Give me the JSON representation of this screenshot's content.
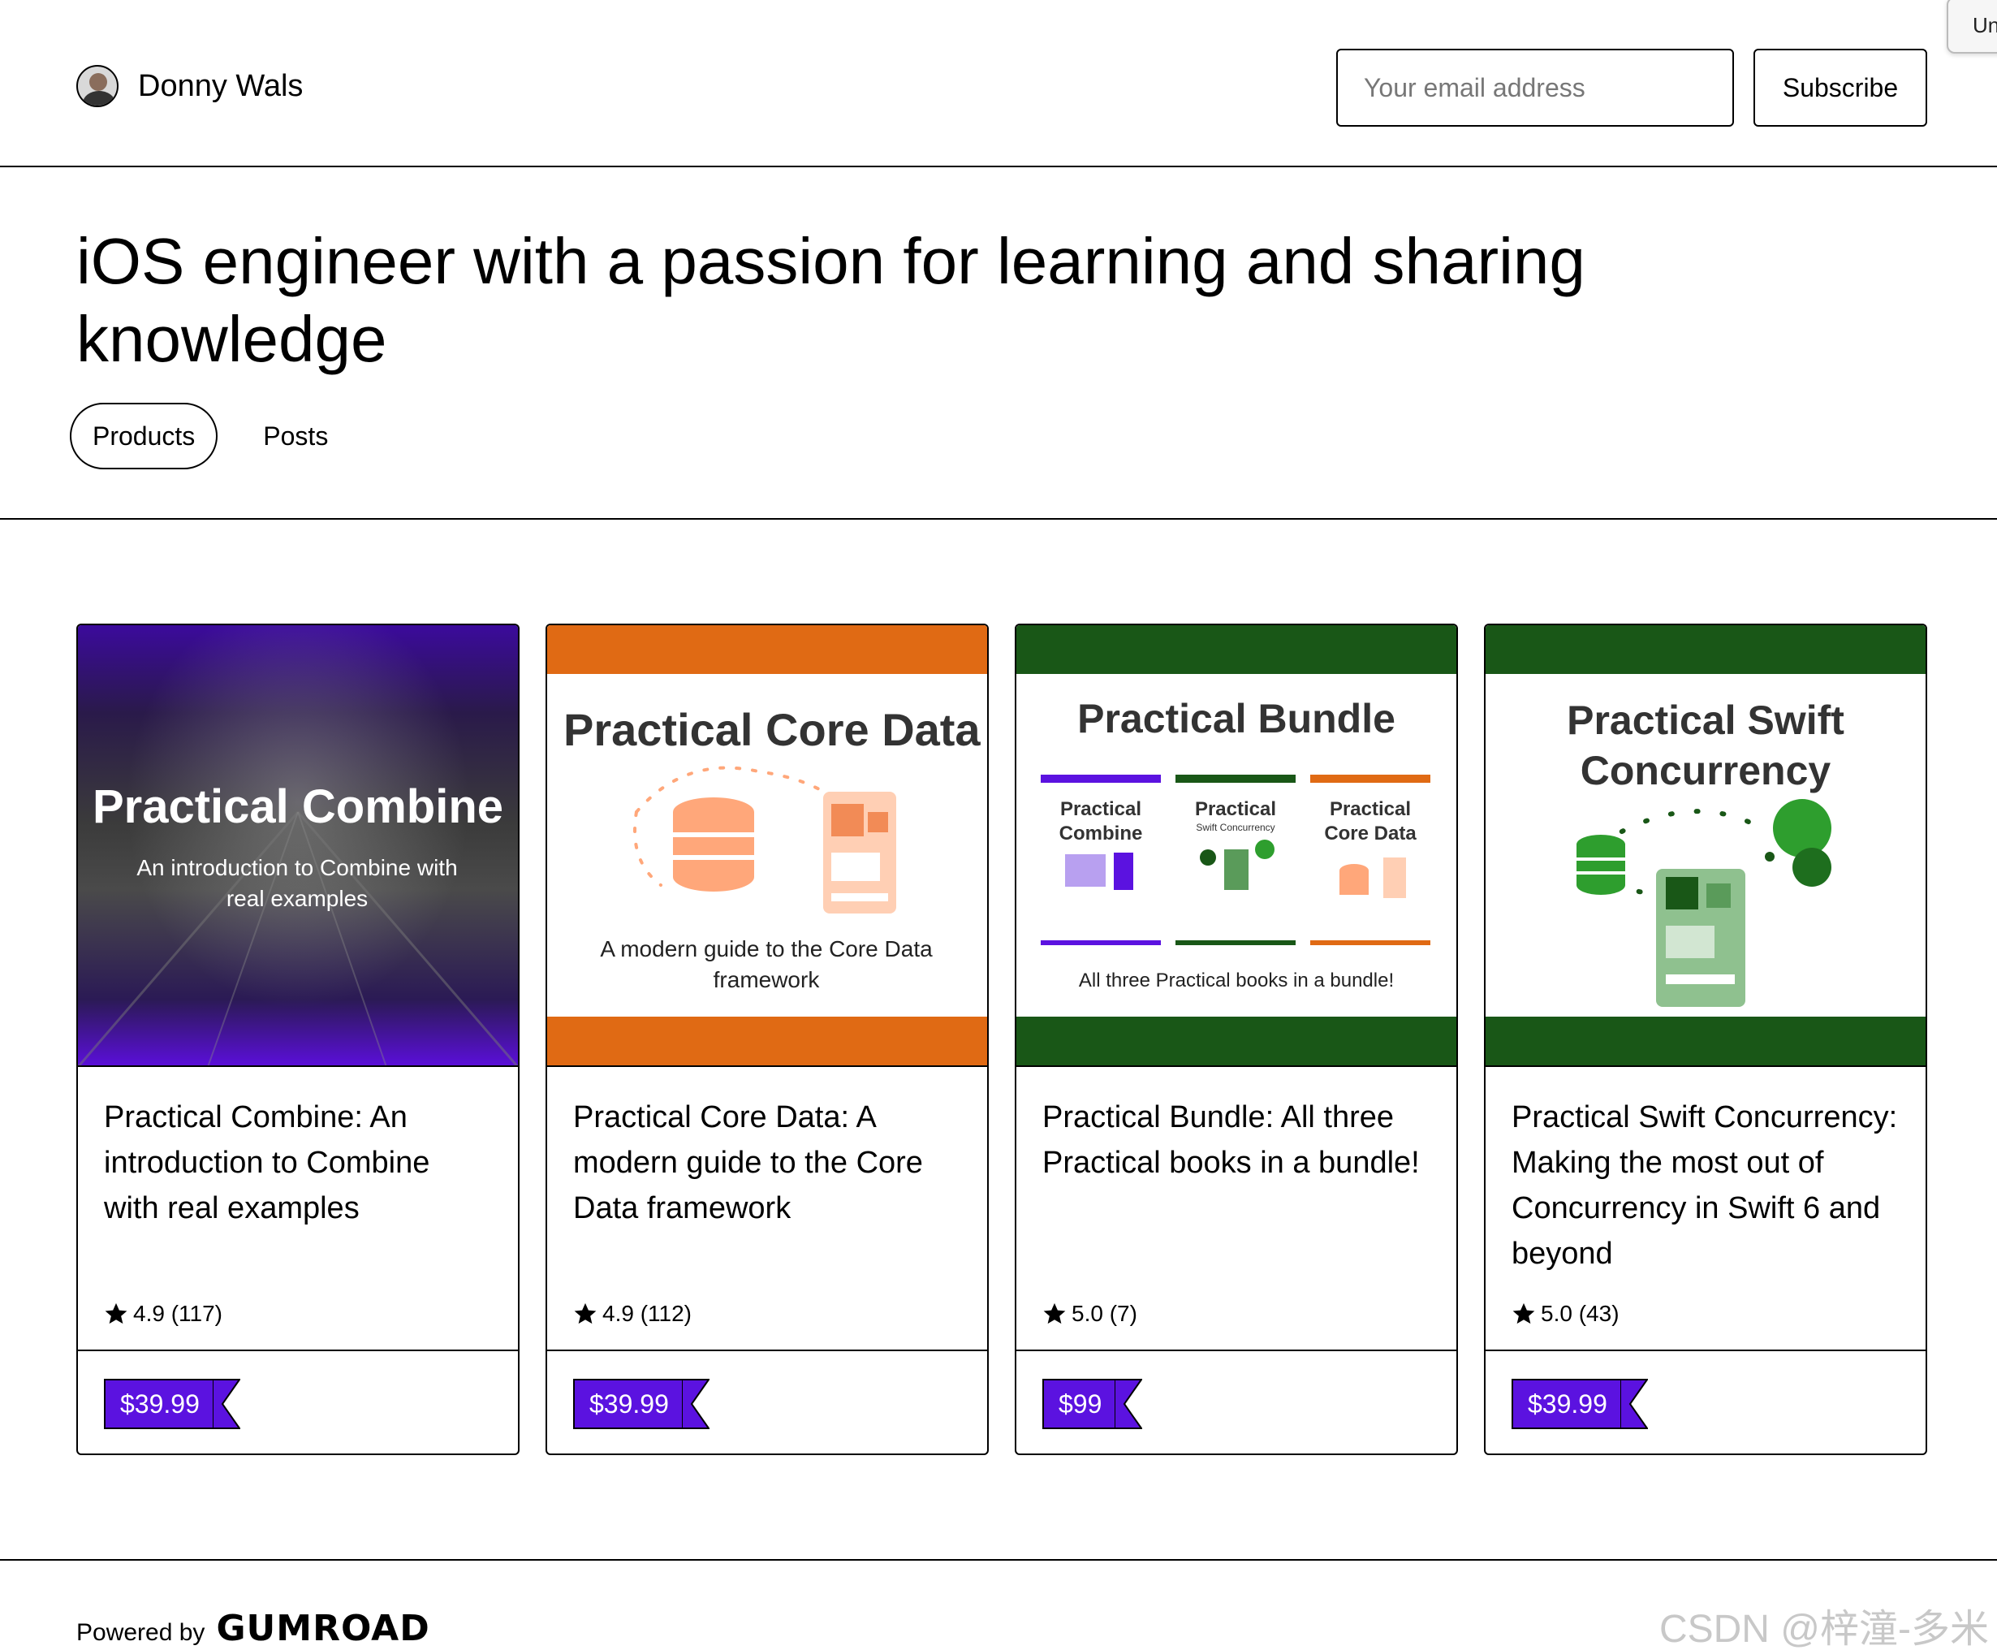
{
  "header": {
    "creator_name": "Donny Wals",
    "email_placeholder": "Your email address",
    "subscribe_label": "Subscribe",
    "corner_tab_label": "Un"
  },
  "hero": {
    "title": "iOS engineer with a passion for learning and sharing knowledge",
    "tabs": [
      {
        "label": "Products",
        "active": true
      },
      {
        "label": "Posts",
        "active": false
      }
    ]
  },
  "products": [
    {
      "title": "Practical Combine: An introduction to Combine with real examples",
      "rating": "4.9",
      "rating_count": "(117)",
      "price": "$39.99",
      "cover": {
        "heading": "Practical Combine",
        "subheading": "An introduction to Combine with real examples",
        "accent": "#5b12e0"
      }
    },
    {
      "title": "Practical Core Data: A modern guide to the Core Data framework",
      "rating": "4.9",
      "rating_count": "(112)",
      "price": "$39.99",
      "cover": {
        "heading": "Practical Core Data",
        "subheading": "A modern guide to the Core Data framework",
        "accent": "#e06a14"
      }
    },
    {
      "title": "Practical Bundle: All three Practical books in a bundle!",
      "rating": "5.0",
      "rating_count": "(7)",
      "price": "$99",
      "cover": {
        "heading": "Practical Bundle",
        "subheading": "All three Practical books in a bundle!",
        "accent": "#195717",
        "books": [
          {
            "title": "Practical Combine",
            "subtitle": "",
            "color": "#5b12e0"
          },
          {
            "title": "Practical",
            "subtitle": "Swift Concurrency",
            "color": "#195717"
          },
          {
            "title": "Practical Core Data",
            "subtitle": "",
            "color": "#e06a14"
          }
        ]
      }
    },
    {
      "title": "Practical Swift Concurrency: Making the most out of Concurrency in Swift 6 and beyond",
      "rating": "5.0",
      "rating_count": "(43)",
      "price": "$39.99",
      "cover": {
        "heading": "Practical Swift Concurrency",
        "accent": "#195717"
      }
    }
  ],
  "footer": {
    "powered_by": "Powered by",
    "brand": "GUMROAD",
    "watermark": "CSDN @梓潼-多米"
  },
  "colors": {
    "price_tag": "#5b12e0",
    "border": "#000000"
  }
}
